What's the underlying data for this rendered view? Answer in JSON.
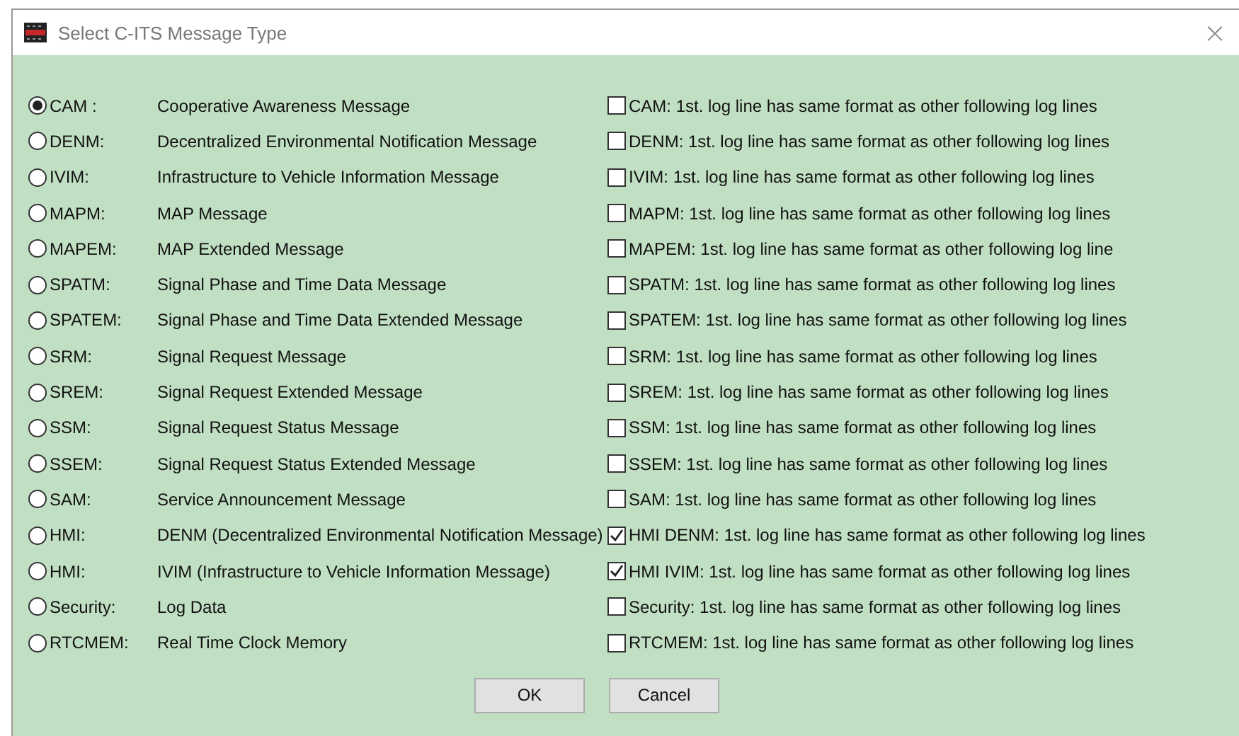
{
  "window": {
    "title": "Select C-ITS Message Type",
    "close": "×"
  },
  "rows": [
    {
      "code": "CAM :",
      "description": "Cooperative Awareness Message",
      "selected": true,
      "option": "CAM: 1st. log line has same format as other following log lines",
      "checked": false
    },
    {
      "code": "DENM:",
      "description": "Decentralized Environmental Notification Message",
      "selected": false,
      "option": "DENM: 1st. log line has same format as other following log lines",
      "checked": false
    },
    {
      "code": "IVIM:",
      "description": "Infrastructure to Vehicle Information Message",
      "selected": false,
      "option": "IVIM: 1st. log line has same format as other following log lines",
      "checked": false
    },
    {
      "code": "MAPM:",
      "description": "MAP Message",
      "selected": false,
      "option": "MAPM: 1st. log line has same format as other following log lines",
      "checked": false
    },
    {
      "code": "MAPEM:",
      "description": "MAP Extended Message",
      "selected": false,
      "option": "MAPEM: 1st. log line has same format as other following log line",
      "checked": false
    },
    {
      "code": "SPATM:",
      "description": "Signal Phase and Time Data Message",
      "selected": false,
      "option": "SPATM: 1st. log line has same format as other following log lines",
      "checked": false
    },
    {
      "code": "SPATEM:",
      "description": "Signal Phase and Time Data Extended Message",
      "selected": false,
      "option": "SPATEM: 1st. log line has same format as other following log lines",
      "checked": false
    },
    {
      "code": "SRM:",
      "description": "Signal Request Message",
      "selected": false,
      "option": "SRM: 1st. log line has same format as other following log lines",
      "checked": false
    },
    {
      "code": "SREM:",
      "description": "Signal Request Extended Message",
      "selected": false,
      "option": "SREM: 1st. log line has same format as other following log lines",
      "checked": false
    },
    {
      "code": "SSM:",
      "description": "Signal Request Status Message",
      "selected": false,
      "option": "SSM: 1st. log line has same format as other following log lines",
      "checked": false
    },
    {
      "code": "SSEM:",
      "description": "Signal Request Status Extended Message",
      "selected": false,
      "option": "SSEM: 1st. log line has same format as other following log lines",
      "checked": false
    },
    {
      "code": "SAM:",
      "description": "Service Announcement Message",
      "selected": false,
      "option": "SAM: 1st. log line has same format as other following log lines",
      "checked": false
    },
    {
      "code": "HMI:",
      "description": "DENM (Decentralized Environmental Notification Message)",
      "selected": false,
      "option": "HMI DENM: 1st. log line has same format as other following log lines",
      "checked": true
    },
    {
      "code": "HMI:",
      "description": "IVIM (Infrastructure to Vehicle Information Message)",
      "selected": false,
      "option": "HMI IVIM: 1st. log line has same format as other following log lines",
      "checked": true
    },
    {
      "code": "Security:",
      "description": "Log Data",
      "selected": false,
      "option": "Security: 1st. log line has same format as other following log lines",
      "checked": false
    },
    {
      "code": "RTCMEM:",
      "description": "Real Time Clock Memory",
      "selected": false,
      "option": "RTCMEM: 1st. log line has same format as other following log lines",
      "checked": false
    }
  ],
  "buttons": [
    "OK",
    "Cancel"
  ]
}
